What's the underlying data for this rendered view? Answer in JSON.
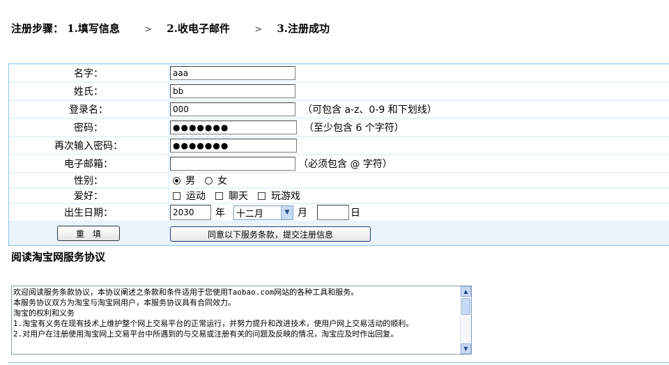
{
  "steps": {
    "prefix": "注册步骤：",
    "step1": "1.填写信息",
    "step2": "2.收电子邮件",
    "step3": "3.注册成功",
    "separator": ">"
  },
  "form": {
    "first_name": {
      "label": "名字：",
      "value": "aaa"
    },
    "last_name": {
      "label": "姓氏：",
      "value": "bb"
    },
    "login": {
      "label": "登录名：",
      "value": "000",
      "hint": "（可包含 a-z、0-9 和下划线）"
    },
    "password": {
      "label": "密码：",
      "masked": "●●●●●●●",
      "hint": "（至少包含 6 个字符）"
    },
    "password_confirm": {
      "label": "再次输入密码：",
      "masked": "●●●●●●●"
    },
    "email": {
      "label": "电子邮箱：",
      "value": "",
      "hint": "（必须包含 @ 字符）"
    },
    "gender": {
      "label": "性别：",
      "options": [
        "男",
        "女"
      ],
      "selected": "男"
    },
    "hobbies": {
      "label": "爱好：",
      "options": [
        "运动",
        "聊天",
        "玩游戏"
      ]
    },
    "birthday": {
      "label": "出生日期：",
      "year": "2030",
      "year_unit": "年",
      "month": "十二月",
      "month_unit": "月",
      "day": "",
      "day_unit": "日"
    },
    "reset_button": "重　填",
    "submit_button": "同意以下服务条款，提交注册信息"
  },
  "agreement": {
    "title": "阅读淘宝网服务协议",
    "text": "欢迎阅读服务条款协议，本协议阐述之条款和条件适用于您使用Taobao.com网站的各种工具和服务。\n本服务协议双方为淘宝与淘宝网用户，本服务协议具有合同效力。\n淘宝的权利和义务\n1.淘宝有义务在现有技术上维护整个网上交易平台的正常运行，并努力提升和改进技术，使用户网上交易活动的顺利。\n2.对用户在注册使用淘宝网上交易平台中所遇到的与交易或注册有关的问题及反映的情况，淘宝应及时作出回复。"
  },
  "colors": {
    "border": "#8cc4e6",
    "row_gap": "#e9f3fb"
  }
}
